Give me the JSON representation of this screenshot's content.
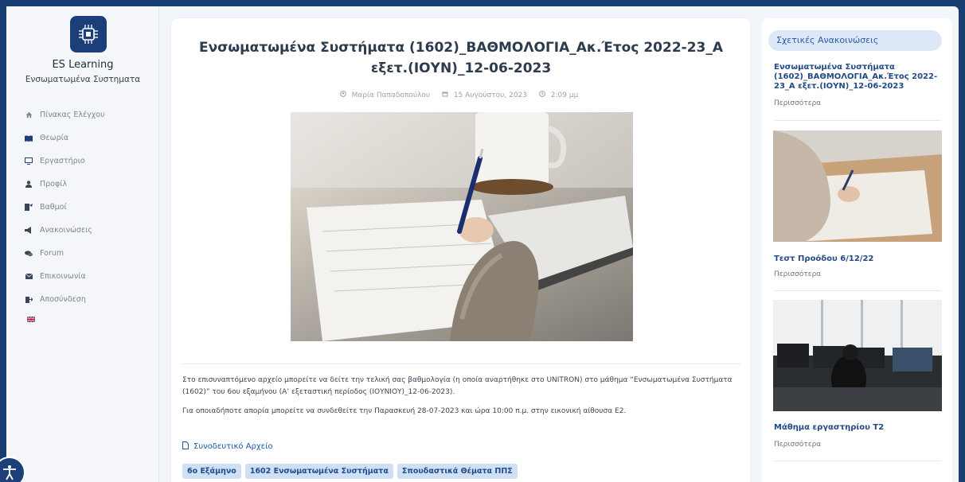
{
  "sidebar": {
    "site_name": "ES Learning",
    "site_subtitle": "Ενσωματωμένα Συστηματα",
    "nav": [
      {
        "label": "Πίνακας Ελέγχου",
        "icon": "home-icon"
      },
      {
        "label": "Θεωρία",
        "icon": "book-icon"
      },
      {
        "label": "Εργαστήριο",
        "icon": "monitor-icon"
      },
      {
        "label": "Προφίλ",
        "icon": "user-icon"
      },
      {
        "label": "Βαθμοί",
        "icon": "grades-icon"
      },
      {
        "label": "Ανακοινώσεις",
        "icon": "megaphone-icon"
      },
      {
        "label": "Forum",
        "icon": "chat-icon"
      },
      {
        "label": "Επικοινωνία",
        "icon": "envelope-icon"
      },
      {
        "label": "Αποσύνδεση",
        "icon": "logout-icon"
      }
    ]
  },
  "post": {
    "title": "Ενσωματωμένα Συστήματα (1602)_ΒΑΘΜΟΛΟΓΙΑ_Ακ.Έτος 2022-23_Α εξετ.(ΙΟΥΝ)_12-06-2023",
    "author": "Μαρία Παπαδοπούλου",
    "date": "15 Αυγούστου, 2023",
    "time": "2:09 μμ",
    "paragraph1": "Στο επισυναπτόμενο αρχείο μπορείτε να δείτε την τελική σας βαθμολογία (η οποία αναρτήθηκε στο UNITRON) στο μάθημα “Ενσωματωμένα Συστήματα (1602)” του 6ου εξαμήνου (Α’ εξεταστική περίοδος (ΙΟΥΝΙΟΥ)_12-06-2023).",
    "paragraph2": "Για οποιαδήποτε απορία μπορείτε να συνδεθείτε την Παρασκευή 28-07-2023 και ώρα 10:00 π.μ. στην εικονική αίθουσα Ε2.",
    "attachment_label": "Συνοδευτικό Αρχείο",
    "tags": [
      "6ο Εξάμηνο",
      "1602 Ενσωματωμένα Συστήματα",
      "Σπουδαστικά Θέματα ΠΠΣ"
    ]
  },
  "related": {
    "heading": "Σχετικές Ανακοινώσεις",
    "items": [
      {
        "title": "Ενσωματωμένα Συστήματα (1602)_ΒΑΘΜΟΛΟΓΙΑ_Ακ.Έτος 2022-23_Α εξετ.(ΙΟΥΝ)_12-06-2023",
        "more": "Περισσότερα"
      },
      {
        "title": "Τεστ Προόδου 6/12/22",
        "more": "Περισσότερα"
      },
      {
        "title": "Μάθημα εργαστηρίου Τ2",
        "more": "Περισσότερα"
      }
    ]
  },
  "colors": {
    "brand": "#1c3f7a",
    "link": "#1e56a8",
    "tag_bg": "#cfe0f4"
  }
}
